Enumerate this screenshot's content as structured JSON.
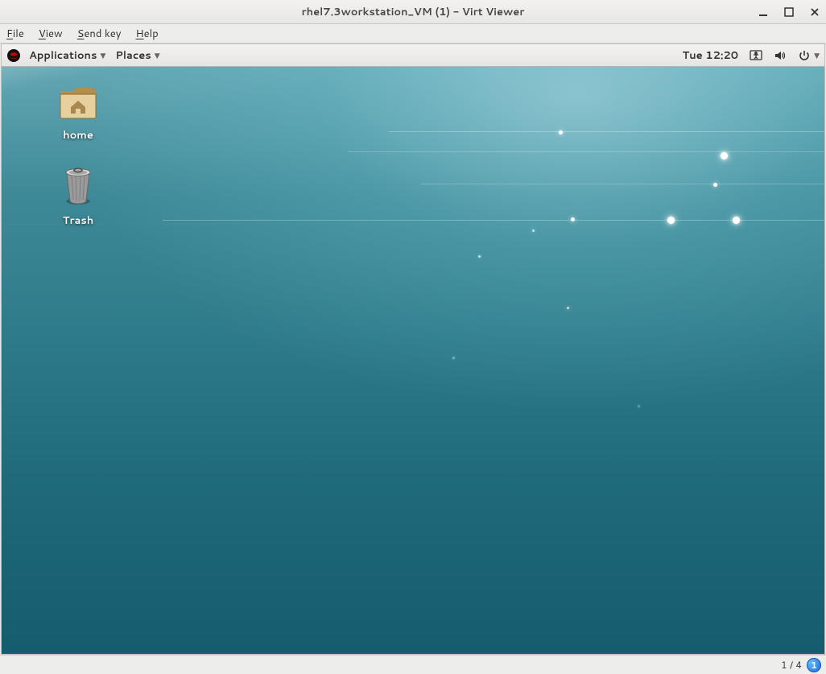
{
  "window": {
    "title": "rhel7.3workstation_VM (1) - Virt Viewer"
  },
  "menubar": {
    "file": "File",
    "view": "View",
    "sendkey": "Send key",
    "help": "Help"
  },
  "guest_topbar": {
    "applications": "Applications",
    "places": "Places",
    "clock": "Tue 12:20"
  },
  "desktop": {
    "home_label": "home",
    "trash_label": "Trash"
  },
  "statusbar": {
    "display_counter": "1 / 4",
    "display_active": "1"
  }
}
